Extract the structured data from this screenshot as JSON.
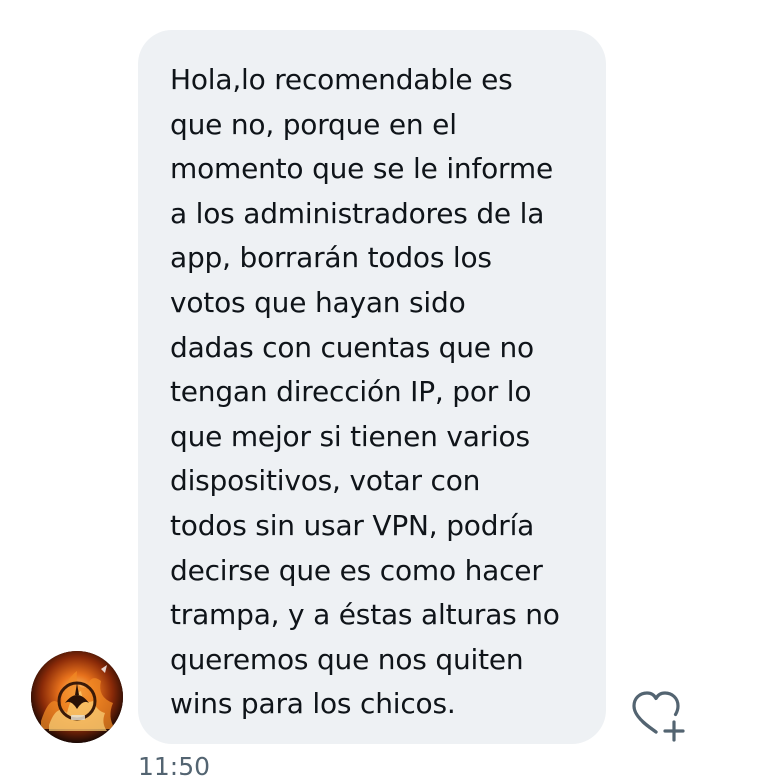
{
  "message": {
    "text": "Hola,lo recomendable es\nque no, porque en el\nmomento que se le informe\na los administradores de la\napp, borrarán todos los\nvotos que hayan sido\ndadas con cuentas que no\ntengan dirección IP, por lo\nque mejor si tienen varios\ndispositivos, votar con\ntodos sin usar VPN, podría\ndecirse que es como hacer\ntrampa, y a éstas alturas no\nqueremos que nos quiten\nwins para los chicos.",
    "timestamp": "11:50"
  },
  "icons": {
    "avatar": "sender-avatar",
    "reaction": "heart-plus-icon"
  },
  "colors": {
    "bubble_background": "#eef1f4",
    "message_text": "#0f1419",
    "timestamp_text": "#536471",
    "icon_stroke": "#536471"
  }
}
